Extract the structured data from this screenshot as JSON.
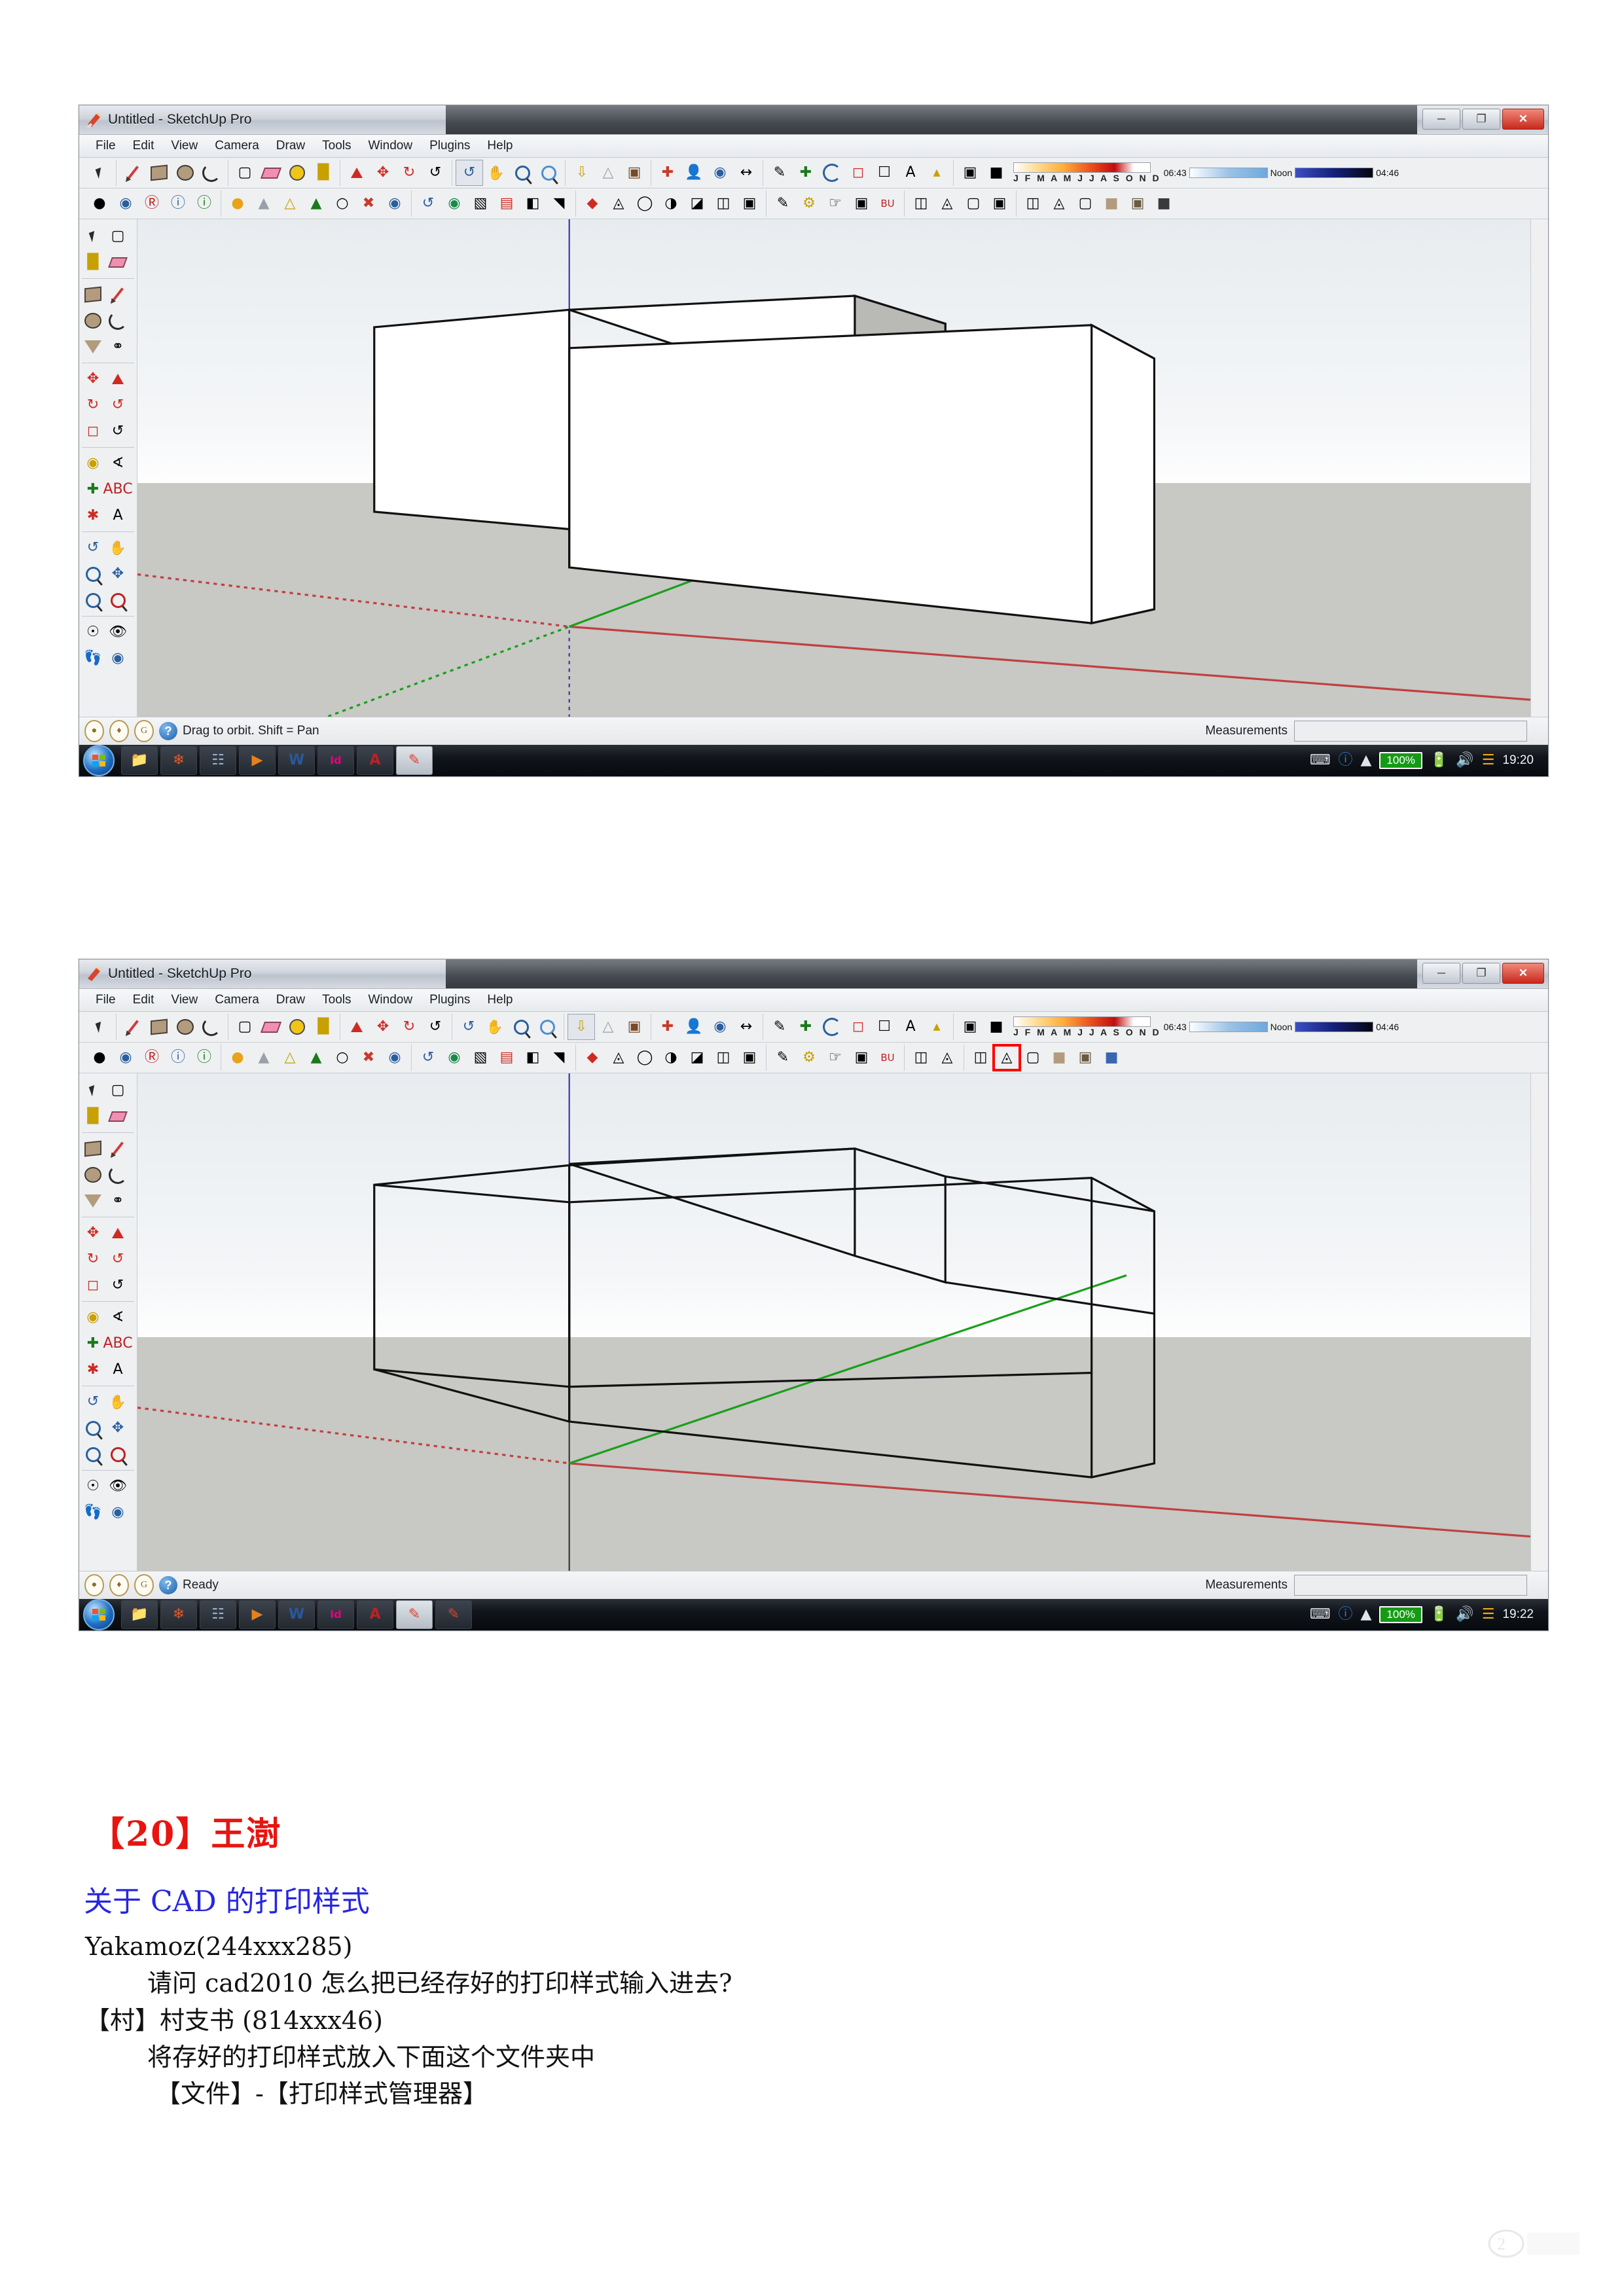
{
  "windows": [
    {
      "title": "Untitled - SketchUp Pro",
      "title_icon": "sketchup-icon",
      "window_buttons": [
        "minimize",
        "restore",
        "close"
      ],
      "menu": [
        "File",
        "Edit",
        "View",
        "Camera",
        "Draw",
        "Tools",
        "Window",
        "Plugins",
        "Help"
      ],
      "shadow_strip": {
        "months": "J F M A M J J A S O N D",
        "sunrise": "06:43",
        "noon": "Noon",
        "sunset": "04:46"
      },
      "status": "Drag to orbit.  Shift = Pan",
      "measurements_label": "Measurements",
      "measurements_value": "",
      "view_style": "shaded",
      "highlight_button": null,
      "taskbar": {
        "start": "windows-start",
        "apps": [
          "explorer",
          "picasa",
          "network",
          "media-player",
          "word",
          "indesign",
          "autocad",
          "sketchup"
        ],
        "battery": "100%",
        "clock": "19:20"
      }
    },
    {
      "title": "Untitled - SketchUp Pro",
      "title_icon": "sketchup-icon",
      "window_buttons": [
        "minimize",
        "restore",
        "close"
      ],
      "menu": [
        "File",
        "Edit",
        "View",
        "Camera",
        "Draw",
        "Tools",
        "Window",
        "Plugins",
        "Help"
      ],
      "shadow_strip": {
        "months": "J F M A M J J A S O N D",
        "sunrise": "06:43",
        "noon": "Noon",
        "sunset": "04:46"
      },
      "status": "Ready",
      "measurements_label": "Measurements",
      "measurements_value": "",
      "view_style": "wireframe",
      "highlight_button": "wireframe-style-button",
      "taskbar": {
        "start": "windows-start",
        "apps": [
          "explorer",
          "picasa",
          "network",
          "media-player",
          "word",
          "indesign",
          "autocad",
          "sketchup",
          "sketchup-2"
        ],
        "battery": "100%",
        "clock": "19:22"
      }
    }
  ],
  "toolbars": {
    "row1_groups": [
      [
        "select-arrow-icon"
      ],
      [
        "line-pencil-icon",
        "rectangle-icon",
        "circle-icon",
        "arc-icon"
      ],
      [
        "make-component-icon",
        "eraser-icon",
        "tape-measure-icon",
        "paint-bucket-icon"
      ],
      [
        "push-pull-icon",
        "move-icon",
        "rotate-icon",
        "follow-me-icon"
      ],
      [
        "orbit-icon",
        "pan-icon",
        "zoom-icon",
        "zoom-extents-icon"
      ],
      [
        "previous-view-icon",
        "next-view-icon",
        "position-camera-icon"
      ],
      [
        "walk-icon",
        "look-around-icon",
        "section-plane-icon"
      ],
      [
        "dimension-icon",
        "text-icon",
        "axes-icon",
        "protractor-icon"
      ],
      [
        "scale-icon",
        "offset-icon",
        "3d-text-icon"
      ],
      [
        "shadow-settings-icon",
        "shadow-toggle-icon"
      ]
    ],
    "row2_groups": [
      [
        "materials-browser-icon",
        "components-icon",
        "ruby-console-icon",
        "help-icon",
        "instructor-icon"
      ],
      [
        "sun-icon",
        "fog-icon",
        "soften-edges-icon",
        "styles-icon",
        "layers-icon"
      ],
      [
        "sandbox-from-contours-icon",
        "smoove-icon",
        "stamp-icon",
        "drape-icon"
      ],
      [
        "solid-tools-icon",
        "outer-shell-icon",
        "intersect-icon",
        "union-icon",
        "subtract-icon",
        "trim-icon",
        "split-icon"
      ],
      [
        "advanced-camera-icon",
        "dynamic-components-icon",
        "photo-match-icon"
      ],
      [
        "iso-view-icon",
        "top-view-icon",
        "front-view-icon",
        "right-view-icon",
        "back-view-icon",
        "left-view-icon"
      ],
      [
        "xray-style-button",
        "wireframe-style-button",
        "hidden-line-style-button",
        "shaded-style-button",
        "shaded-texture-style-button",
        "monochrome-style-button"
      ]
    ],
    "left_tools": [
      "select-arrow-icon",
      "make-component-icon",
      "paint-bucket-icon",
      "eraser-icon",
      "rectangle-icon",
      "line-pencil-icon",
      "circle-icon",
      "arc-icon",
      "polygon-icon",
      "freehand-icon",
      "move-icon",
      "push-pull-icon",
      "rotate-icon",
      "follow-me-icon",
      "scale-icon",
      "offset-icon",
      "tape-measure-icon",
      "protractor-icon",
      "axes-icon",
      "dimension-icon",
      "3d-text-icon",
      "text-icon",
      "orbit-icon",
      "pan-icon",
      "zoom-icon",
      "zoom-extents-icon",
      "zoom-window-icon",
      "previous-view-icon",
      "position-camera-icon",
      "look-around-icon",
      "walk-icon",
      "section-plane-icon"
    ]
  },
  "document": {
    "heading": "【20】王澍",
    "subtitle": "关于 CAD 的打印样式",
    "lines": [
      {
        "text": "Yakamoz(244xxx285)",
        "indent": 0
      },
      {
        "text": "请问 cad2010 怎么把已经存好的打印样式输入进去?",
        "indent": 2
      },
      {
        "text": "【村】村支书 (814xxx46)",
        "indent": 1
      },
      {
        "text": "将存好的打印样式放入下面这个文件夹中",
        "indent": 2
      },
      {
        "text": "【文件】-【打印样式管理器】",
        "indent": 3
      }
    ]
  },
  "colors": {
    "heading_red": "#e8140f",
    "subtitle_blue": "#2626e0",
    "highlight_red": "#ff0000",
    "battery_green": "#169a16",
    "axis_red": "#c04040",
    "axis_green": "#19a019",
    "axis_blue": "#3333aa",
    "ground": "#c8c8c4"
  }
}
